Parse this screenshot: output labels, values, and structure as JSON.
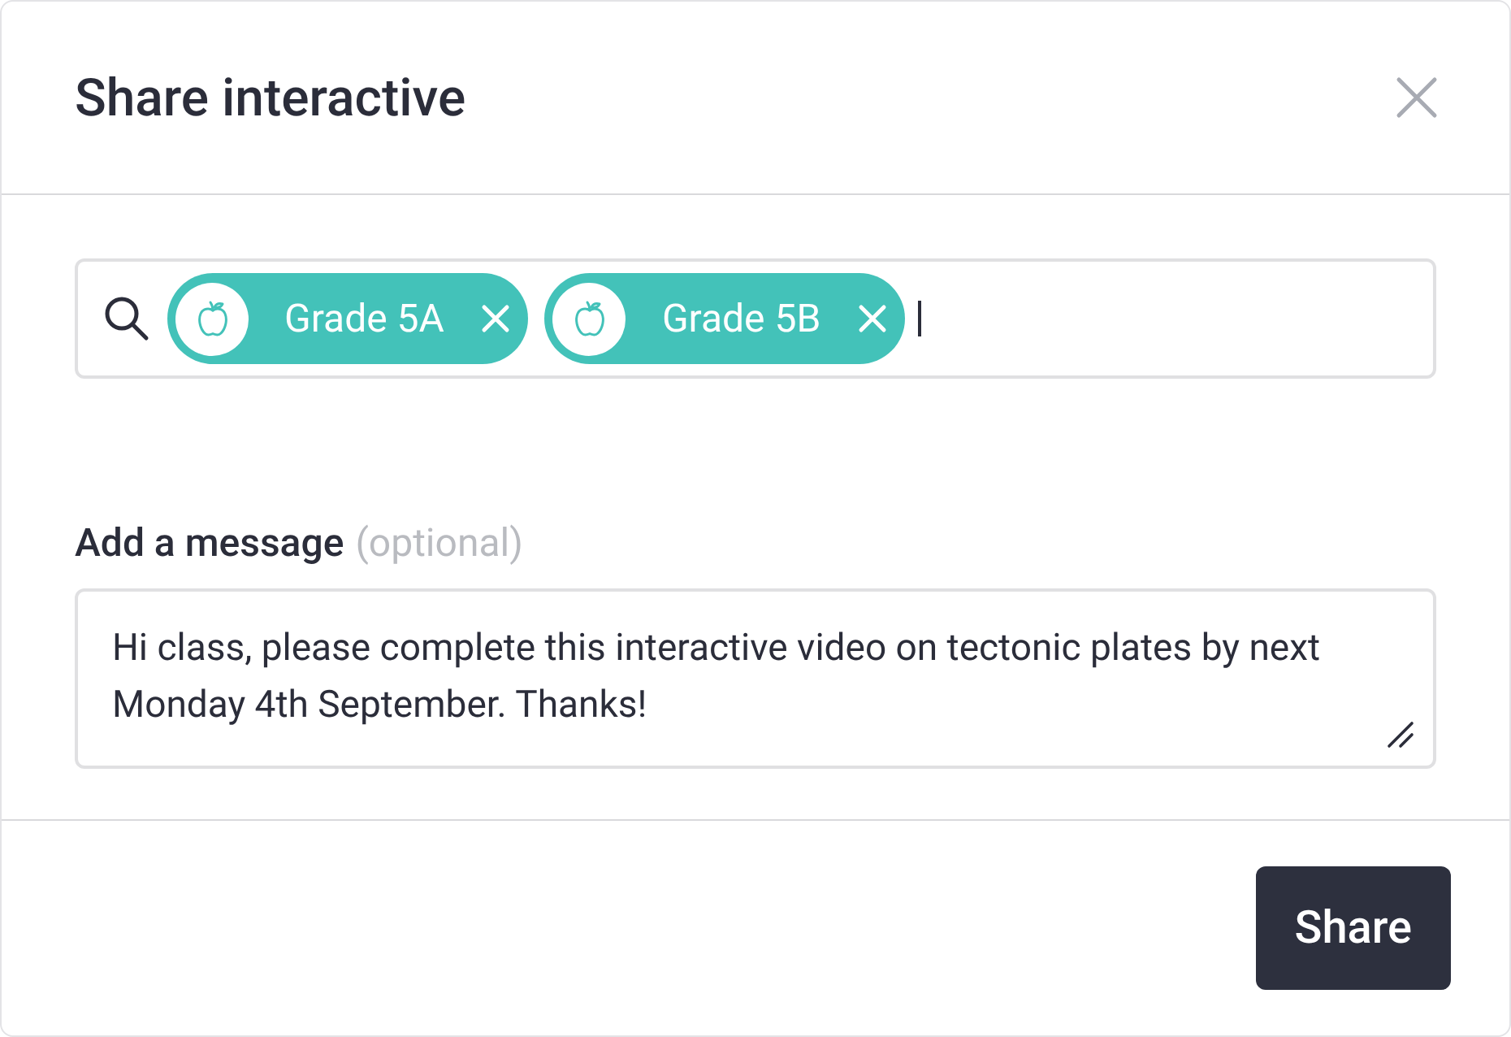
{
  "dialog": {
    "title": "Share interactive"
  },
  "recipients": {
    "tags": [
      {
        "label": "Grade 5A"
      },
      {
        "label": "Grade 5B"
      }
    ]
  },
  "message": {
    "label": "Add a message",
    "hint": "(optional)",
    "value": "Hi class, please complete this interactive video on tectonic plates by next Monday 4th September. Thanks!"
  },
  "buttons": [
    {
      "label": "Share"
    }
  ]
}
